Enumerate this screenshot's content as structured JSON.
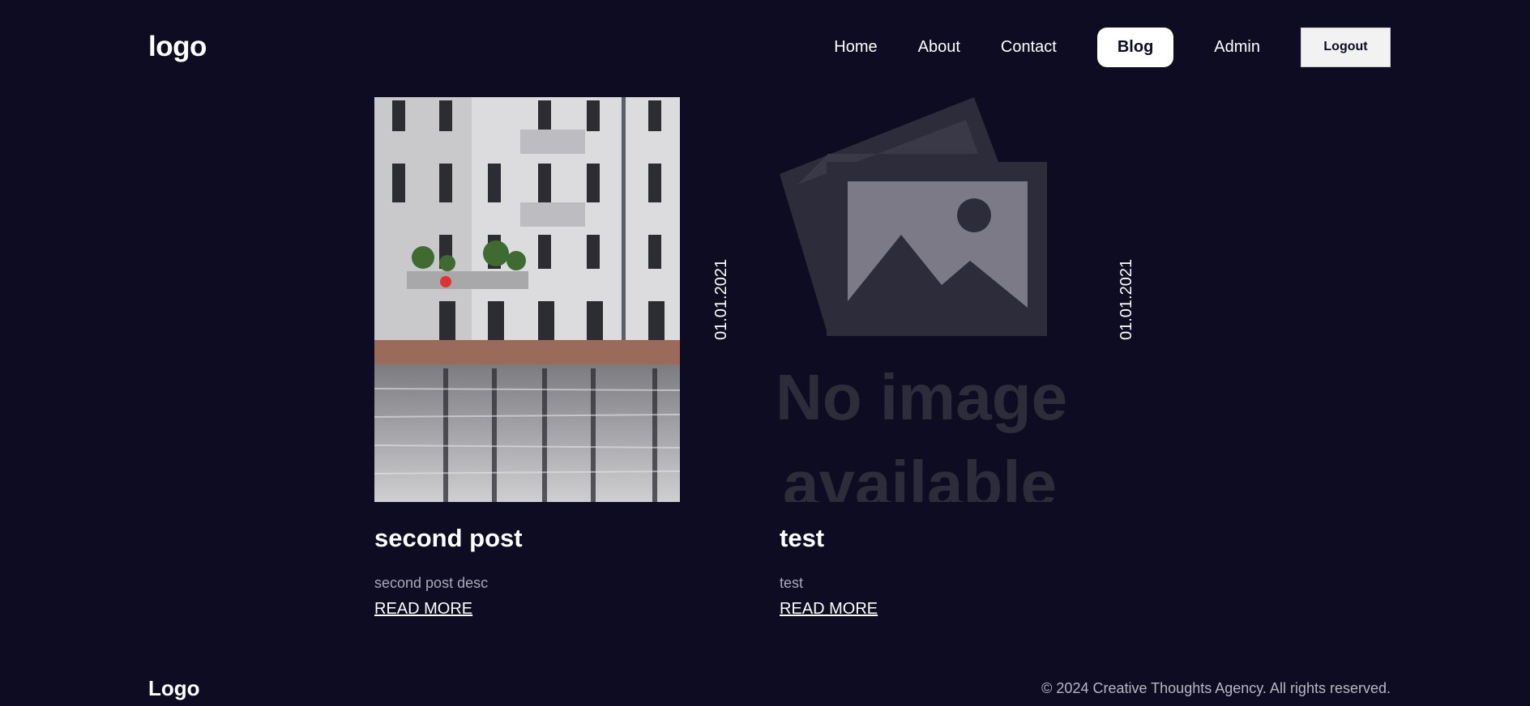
{
  "header": {
    "logo": "logo",
    "nav": [
      {
        "label": "Home"
      },
      {
        "label": "About"
      },
      {
        "label": "Contact"
      },
      {
        "label": "Blog",
        "active": true
      },
      {
        "label": "Admin"
      }
    ],
    "logout_label": "Logout"
  },
  "posts": [
    {
      "title": "second post",
      "description": "second post desc",
      "date": "01.01.2021",
      "link": "READ MORE",
      "image": "building-photo"
    },
    {
      "title": "test",
      "description": "test",
      "date": "01.01.2021",
      "link": "READ MORE",
      "image": "no-image-placeholder",
      "placeholder_text": [
        "No image",
        "available"
      ]
    }
  ],
  "footer": {
    "logo": "Logo",
    "copyright": "© 2024 Creative Thoughts Agency. All rights reserved."
  },
  "colors": {
    "background": "#0d0c22",
    "text": "#ffffff",
    "muted": "#a9a8b8"
  }
}
